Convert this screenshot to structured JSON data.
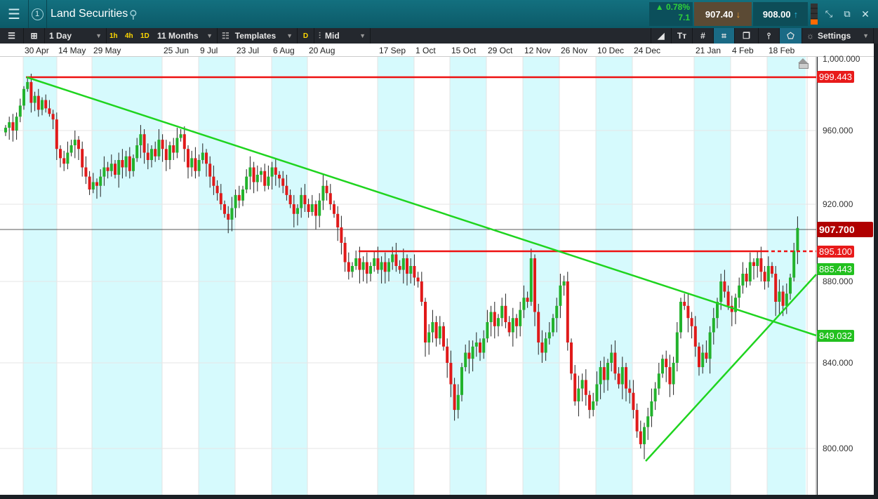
{
  "header": {
    "title": "Land Securities",
    "layout_number": "1",
    "change_pct": "▲ 0.78%",
    "change_abs": "7.1",
    "sell_price": "907.40",
    "buy_price": "908.00"
  },
  "toolbar": {
    "interval": "1 Day",
    "quick_1h": "1h",
    "quick_4h": "4h",
    "quick_1d": "1D",
    "range": "11 Months",
    "templates": "Templates",
    "d_badge": "D",
    "price_type": "Mid",
    "settings": "Settings"
  },
  "colors": {
    "up": "#22b22c",
    "down": "#e01a1a",
    "band": "#d6fafd",
    "trend": "#1fd41f",
    "resistance": "#ee1111"
  },
  "dates": [
    "30 Apr",
    "14 May",
    "29 May",
    "25 Jun",
    "9 Jul",
    "23 Jul",
    "6 Aug",
    "20 Aug",
    "17 Sep",
    "1 Oct",
    "15 Oct",
    "29 Oct",
    "12 Nov",
    "26 Nov",
    "10 Dec",
    "24 Dec",
    "21 Jan",
    "4 Feb",
    "18 Feb"
  ],
  "chart_data": {
    "type": "candlestick",
    "title": "Land Securities",
    "y_ticks": [
      "1,000.000",
      "960.000",
      "920.000",
      "880.000",
      "840.000",
      "800.000"
    ],
    "current_price": "907.700",
    "levels": [
      {
        "name": "resistance-high",
        "value": "999.443",
        "color": "red"
      },
      {
        "name": "resistance-mid",
        "value": "895.100",
        "color": "red"
      },
      {
        "name": "rising-trend",
        "value": "885.443",
        "color": "green"
      },
      {
        "name": "falling-trend",
        "value": "849.032",
        "color": "green"
      }
    ],
    "closes": [
      962,
      966,
      960,
      970,
      978,
      990,
      995,
      980,
      985,
      975,
      982,
      976,
      972,
      968,
      950,
      945,
      942,
      948,
      952,
      955,
      950,
      940,
      935,
      928,
      932,
      930,
      935,
      940,
      938,
      942,
      936,
      944,
      940,
      946,
      938,
      945,
      952,
      958,
      948,
      944,
      950,
      946,
      955,
      950,
      944,
      952,
      948,
      956,
      958,
      950,
      940,
      945,
      938,
      944,
      948,
      942,
      935,
      930,
      926,
      920,
      915,
      912,
      918,
      925,
      922,
      928,
      935,
      940,
      932,
      936,
      938,
      930,
      935,
      940,
      936,
      934,
      930,
      925,
      920,
      915,
      918,
      925,
      920,
      916,
      920,
      914,
      922,
      930,
      926,
      920,
      915,
      908,
      900,
      890,
      885,
      888,
      892,
      886,
      890,
      884,
      888,
      892,
      886,
      890,
      885,
      890,
      894,
      888,
      886,
      892,
      884,
      888,
      882,
      880,
      870,
      850,
      855,
      860,
      852,
      858,
      848,
      840,
      830,
      818,
      825,
      838,
      845,
      842,
      848,
      850,
      845,
      852,
      860,
      865,
      858,
      862,
      868,
      860,
      855,
      862,
      858,
      866,
      872,
      870,
      892,
      865,
      850,
      845,
      852,
      855,
      862,
      868,
      878,
      880,
      850,
      835,
      822,
      828,
      832,
      825,
      818,
      822,
      830,
      838,
      832,
      840,
      845,
      835,
      830,
      838,
      828,
      826,
      818,
      808,
      802,
      810,
      815,
      822,
      828,
      835,
      842,
      838,
      830,
      840,
      855,
      870,
      868,
      862,
      858,
      848,
      838,
      845,
      842,
      855,
      862,
      870,
      880,
      875,
      868,
      865,
      872,
      878,
      884,
      880,
      890,
      888,
      892,
      885,
      880,
      888,
      884,
      870,
      875,
      868,
      874,
      882,
      896,
      907.7
    ]
  }
}
